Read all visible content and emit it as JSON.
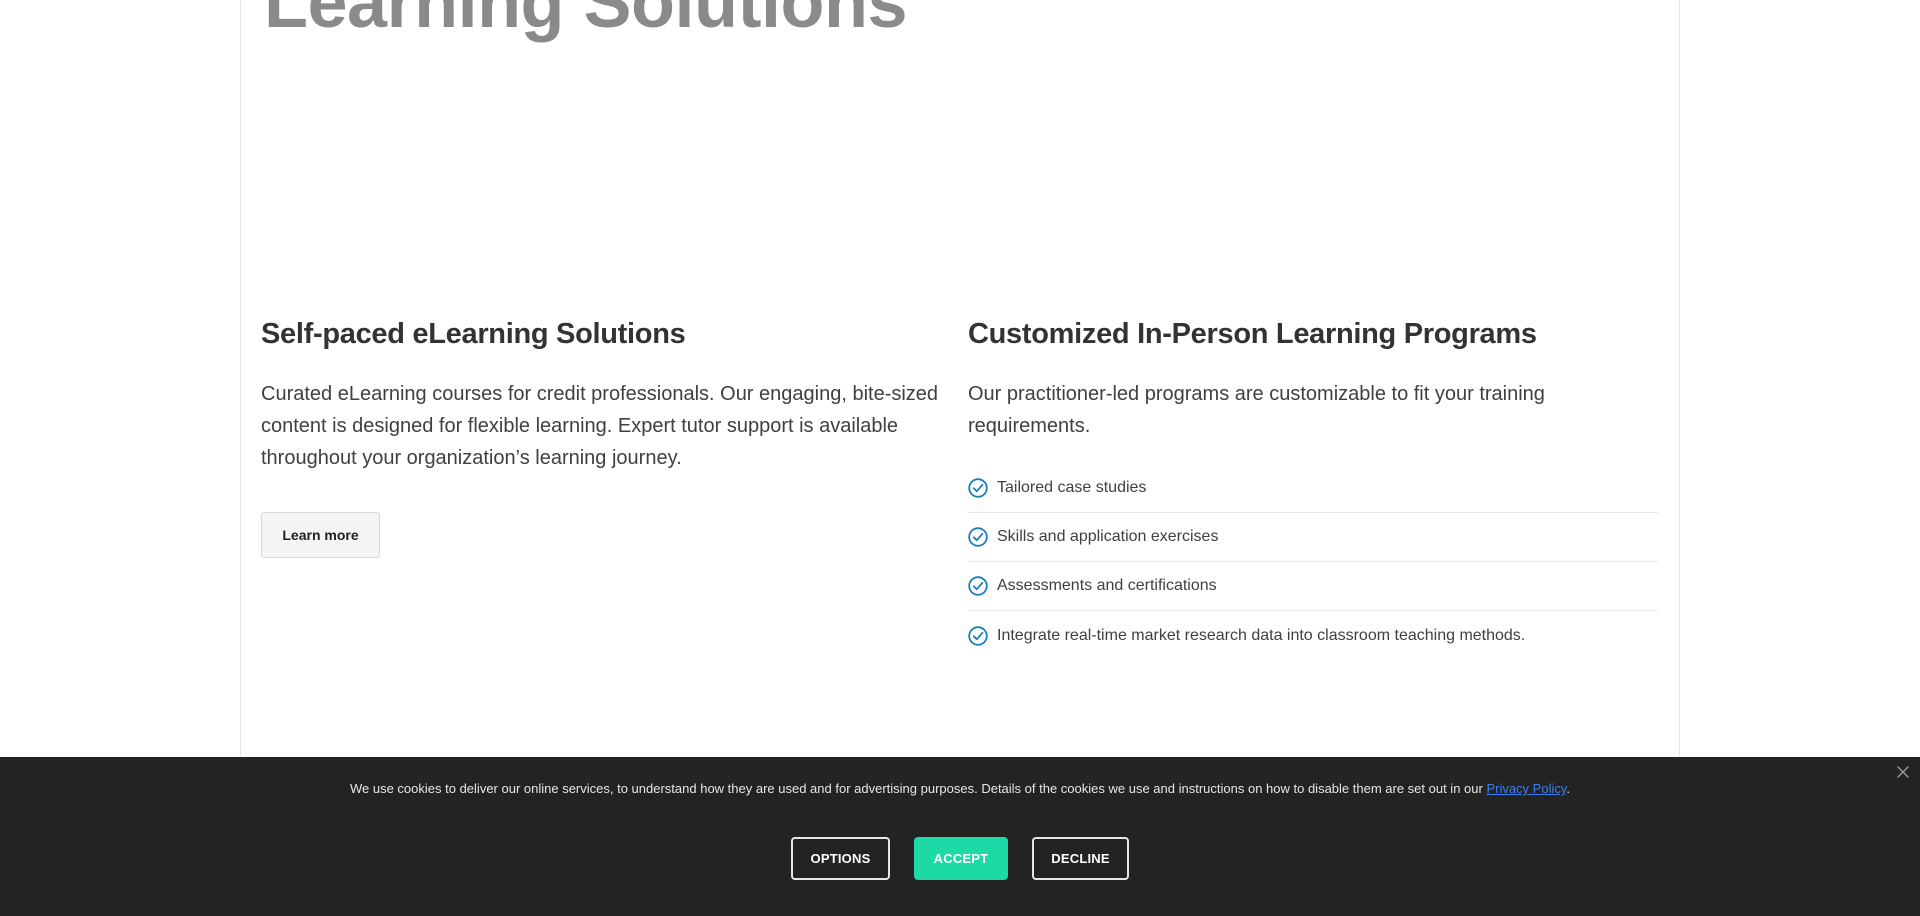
{
  "hero": {
    "title": "Learning Solutions"
  },
  "left_column": {
    "heading": "Self-paced eLearning Solutions",
    "description": "Curated eLearning courses for credit professionals. Our engaging, bite-sized content is designed for flexible learning. Expert tutor support is available throughout your organization’s learning journey.",
    "button_label": "Learn more"
  },
  "right_column": {
    "heading": "Customized In-Person Learning Programs",
    "description": "Our practitioner-led programs are customizable to fit your training requirements.",
    "features": [
      "Tailored case studies",
      "Skills and application exercises",
      "Assessments and certifications",
      "Integrate real-time market research data into classroom teaching methods."
    ],
    "feature_icon": "check-circle-icon"
  },
  "cookie_banner": {
    "text": "We use cookies to deliver our online services, to understand how they are used and for advertising purposes. Details of the cookies we use and instructions on how to disable them are set out in our ",
    "link_text": "Privacy Policy",
    "text_end": ".",
    "close_icon": "close-icon",
    "buttons": {
      "options": "OPTIONS",
      "accept": "ACCEPT",
      "decline": "DECLINE"
    }
  },
  "colors": {
    "accent_check": "#1a7fb8",
    "accept_button": "#1cd9a5",
    "cookie_background": "#232323",
    "link": "#3d7ef0"
  }
}
